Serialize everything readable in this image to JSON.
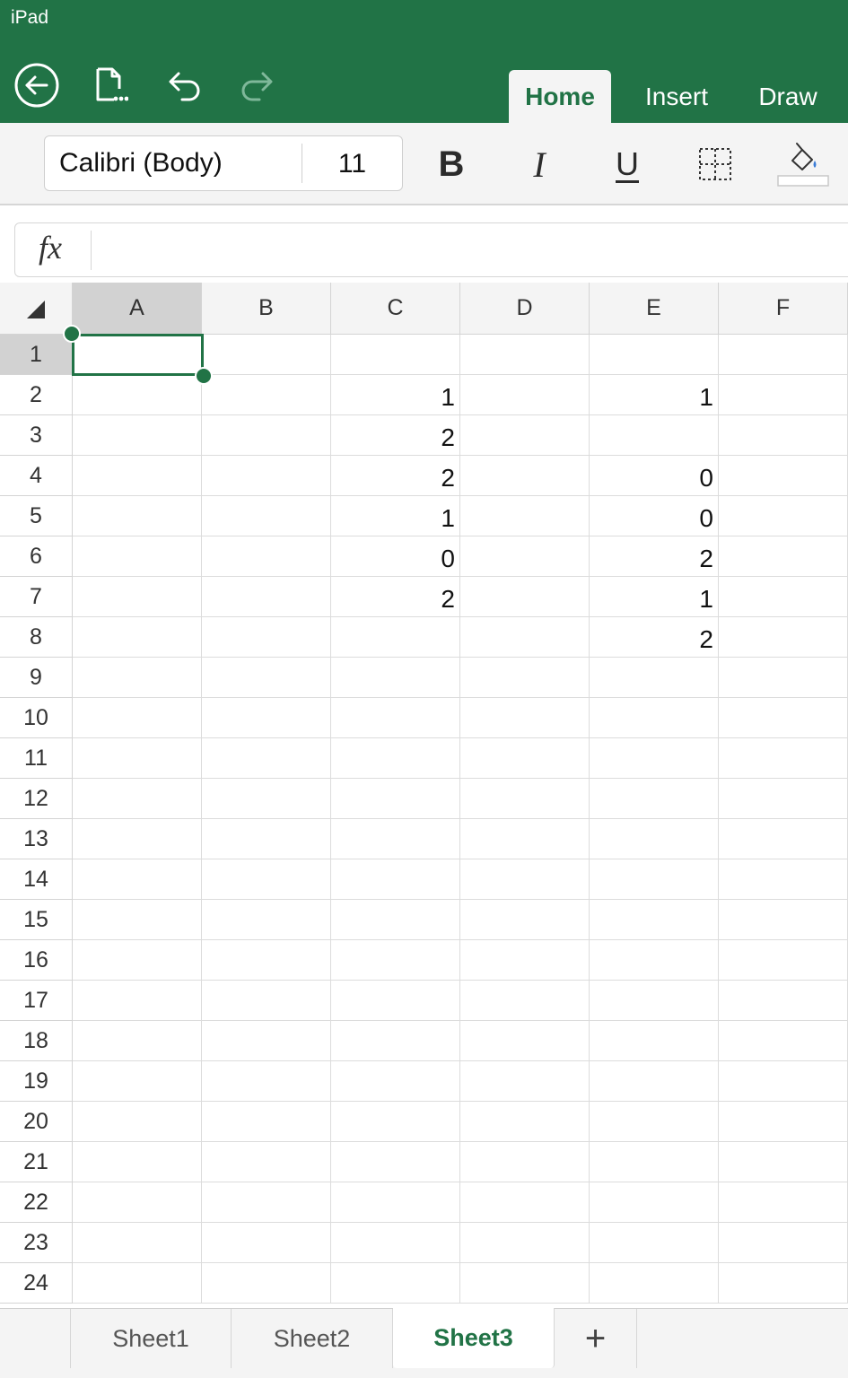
{
  "status_bar": {
    "device": "iPad"
  },
  "ribbon": {
    "tabs": [
      {
        "label": "Home",
        "active": true
      },
      {
        "label": "Insert",
        "active": false
      },
      {
        "label": "Draw",
        "active": false
      }
    ],
    "icons": {
      "back": "back-arrow-circle-icon",
      "file": "file-more-icon",
      "undo": "undo-icon",
      "redo": "redo-icon"
    }
  },
  "toolbar": {
    "font_name": "Calibri (Body)",
    "font_size": "11",
    "bold_label": "B",
    "italic_label": "I",
    "underline_label": "U",
    "borders_icon": "borders-icon",
    "fill_icon": "fill-color-bucket-icon"
  },
  "formula_bar": {
    "fx_label": "fx",
    "value": ""
  },
  "grid": {
    "columns": [
      "A",
      "B",
      "C",
      "D",
      "E",
      "F"
    ],
    "rows": [
      "1",
      "2",
      "3",
      "4",
      "5",
      "6",
      "7",
      "8",
      "9",
      "10",
      "11",
      "12",
      "13",
      "14",
      "15",
      "16",
      "17",
      "18",
      "19",
      "20",
      "21",
      "22",
      "23",
      "24"
    ],
    "selected_cell": "A1",
    "cells": {
      "C2": "1",
      "C3": "2",
      "C4": "2",
      "C5": "1",
      "C6": "0",
      "C7": "2",
      "E2": "1",
      "E4": "0",
      "E5": "0",
      "E6": "2",
      "E7": "1",
      "E8": "2"
    }
  },
  "sheets": {
    "tabs": [
      {
        "label": "Sheet1",
        "active": false
      },
      {
        "label": "Sheet2",
        "active": false
      },
      {
        "label": "Sheet3",
        "active": true
      }
    ],
    "add_label": "+"
  },
  "colors": {
    "accent": "#217346",
    "header_bg": "#f4f4f4",
    "selected_header_bg": "#d2d2d2"
  }
}
